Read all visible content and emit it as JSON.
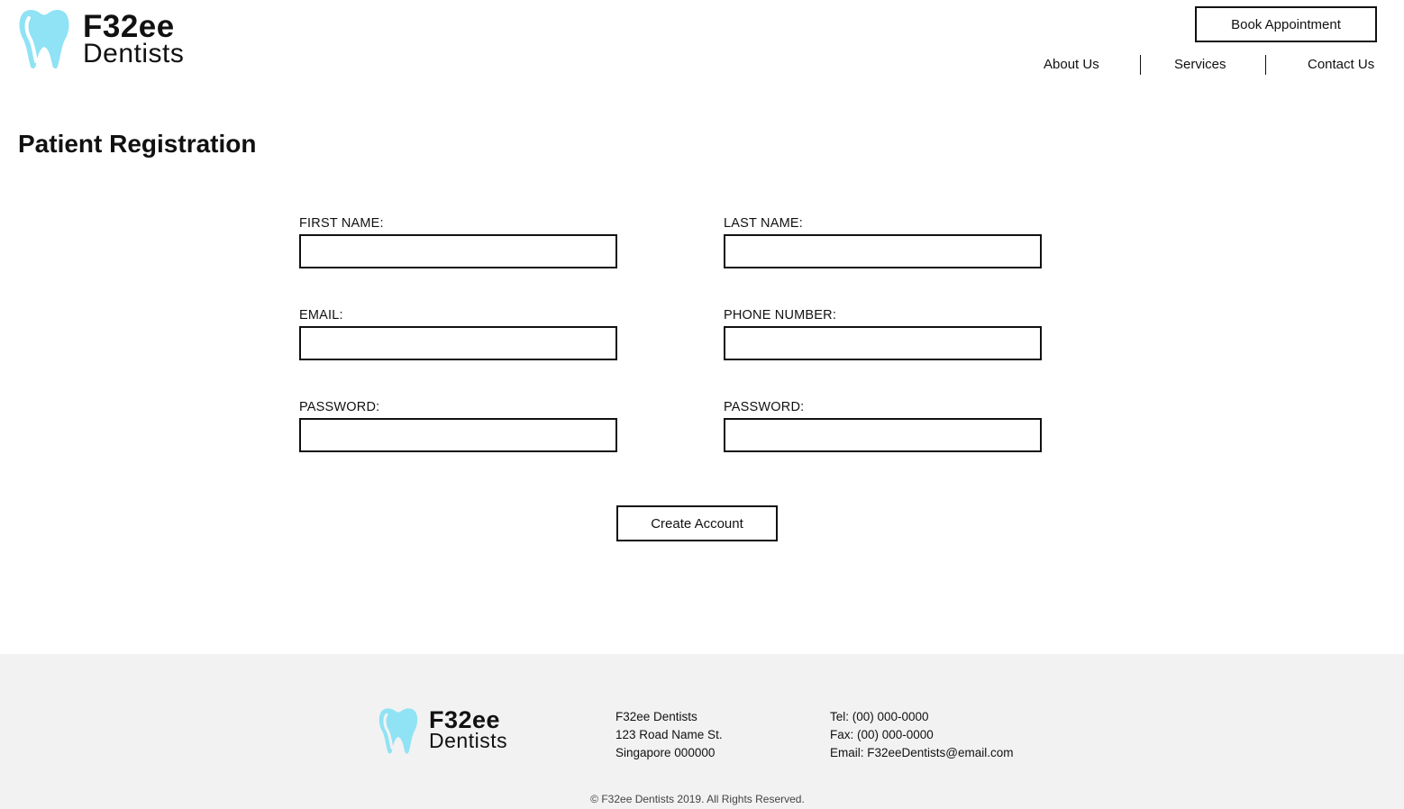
{
  "brand": {
    "name": "F32ee",
    "subtitle": "Dentists",
    "logo_icon": "tooth-icon",
    "accent_color": "#8fe3f5"
  },
  "header": {
    "book_button": "Book Appointment",
    "nav": [
      {
        "label": "About Us"
      },
      {
        "label": "Services"
      },
      {
        "label": "Contact Us"
      }
    ]
  },
  "page": {
    "title": "Patient Registration"
  },
  "form": {
    "first_name": {
      "label": "FIRST NAME:",
      "value": ""
    },
    "last_name": {
      "label": "LAST NAME:",
      "value": ""
    },
    "email": {
      "label": "EMAIL:",
      "value": ""
    },
    "phone": {
      "label": "PHONE NUMBER:",
      "value": ""
    },
    "password": {
      "label": "PASSWORD:",
      "value": ""
    },
    "password_confirm": {
      "label": "PASSWORD:",
      "value": ""
    },
    "submit_label": "Create Account"
  },
  "footer": {
    "address": [
      "F32ee Dentists",
      "123 Road Name St.",
      "Singapore 000000"
    ],
    "contact": [
      "Tel: (00) 000-0000",
      "Fax: (00) 000-0000",
      "Email: F32eeDentists@email.com"
    ],
    "copyright": "© F32ee Dentists 2019. All Rights Reserved.",
    "background": "#f2f2f2"
  }
}
